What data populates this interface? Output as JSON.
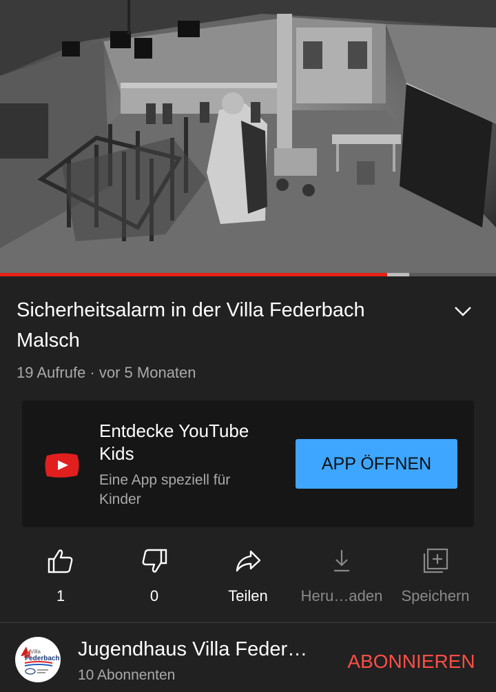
{
  "video": {
    "progress_fraction": 0.78
  },
  "title": "Sicherheitsalarm in der Villa Federbach Malsch",
  "meta": {
    "views": "19 Aufrufe",
    "separator": " · ",
    "age": "vor 5 Monaten"
  },
  "kids_promo": {
    "title": "Entdecke YouTube Kids",
    "description": "Eine App speziell für Kinder",
    "button_label": "APP ÖFFNEN",
    "logo_icon": "youtube-kids-icon",
    "accent_color": "#3ea6ff"
  },
  "actions": [
    {
      "name": "like",
      "label": "1",
      "icon": "thumbs-up-icon",
      "enabled": true
    },
    {
      "name": "dislike",
      "label": "0",
      "icon": "thumbs-down-icon",
      "enabled": true
    },
    {
      "name": "share",
      "label": "Teilen",
      "icon": "share-icon",
      "enabled": true
    },
    {
      "name": "download",
      "label": "Heru…aden",
      "icon": "download-icon",
      "enabled": false
    },
    {
      "name": "save",
      "label": "Speichern",
      "icon": "add-to-playlist-icon",
      "enabled": false
    }
  ],
  "channel": {
    "name": "Jugendhaus Villa Feder…",
    "subscribers": "10 Abonnenten",
    "subscribe_label": "ABONNIEREN",
    "subscribe_color": "#ff4e45",
    "avatar_logo_text": "Villa Federbach"
  },
  "colors": {
    "background": "#212121",
    "progress": "#e62117"
  }
}
